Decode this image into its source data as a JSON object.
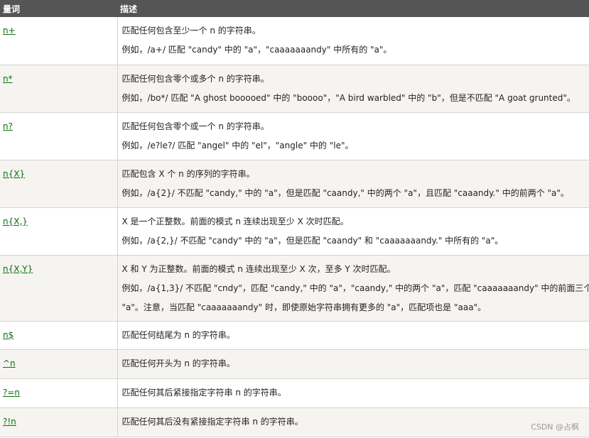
{
  "header": {
    "col1": "量词",
    "col2": "描述"
  },
  "rows": [
    {
      "quantifier": "n+",
      "lines": [
        "匹配任何包含至少一个 n 的字符串。",
        "例如，/a+/ 匹配 \"candy\" 中的 \"a\"，\"caaaaaaandy\" 中所有的 \"a\"。"
      ]
    },
    {
      "quantifier": "n*",
      "lines": [
        "匹配任何包含零个或多个 n 的字符串。",
        "例如，/bo*/ 匹配 \"A ghost booooed\" 中的 \"boooo\"，\"A bird warbled\" 中的 \"b\"，但是不匹配 \"A goat grunted\"。"
      ]
    },
    {
      "quantifier": "n?",
      "lines": [
        "匹配任何包含零个或一个 n 的字符串。",
        "例如，/e?le?/ 匹配 \"angel\" 中的 \"el\"，\"angle\" 中的 \"le\"。"
      ]
    },
    {
      "quantifier": "n{X}",
      "lines": [
        "匹配包含 X 个 n 的序列的字符串。",
        "例如，/a{2}/ 不匹配 \"candy,\" 中的 \"a\"，但是匹配 \"caandy,\" 中的两个 \"a\"，且匹配 \"caaandy.\" 中的前两个 \"a\"。"
      ]
    },
    {
      "quantifier": "n{X,}",
      "lines": [
        "X 是一个正整数。前面的模式 n 连续出现至少 X 次时匹配。",
        "例如，/a{2,}/ 不匹配 \"candy\" 中的 \"a\"，但是匹配 \"caandy\" 和 \"caaaaaaandy.\" 中所有的 \"a\"。"
      ]
    },
    {
      "quantifier": "n{X,Y}",
      "lines": [
        "X 和 Y 为正整数。前面的模式 n 连续出现至少 X 次，至多 Y 次时匹配。",
        "例如，/a{1,3}/ 不匹配 \"cndy\"，匹配 \"candy,\" 中的 \"a\"，\"caandy,\" 中的两个 \"a\"，匹配 \"caaaaaaandy\" 中的前面三个",
        "\"a\"。注意，当匹配 \"caaaaaaandy\" 时，即使原始字符串拥有更多的 \"a\"，匹配项也是 \"aaa\"。"
      ]
    },
    {
      "quantifier": "n$",
      "lines": [
        "匹配任何结尾为 n 的字符串。"
      ]
    },
    {
      "quantifier": "^n",
      "lines": [
        "匹配任何开头为 n 的字符串。"
      ]
    },
    {
      "quantifier": "?=n",
      "lines": [
        "匹配任何其后紧接指定字符串 n 的字符串。"
      ]
    },
    {
      "quantifier": "?!n",
      "lines": [
        "匹配任何其后没有紧接指定字符串 n 的字符串。"
      ]
    }
  ],
  "watermark": "CSDN @占枫"
}
